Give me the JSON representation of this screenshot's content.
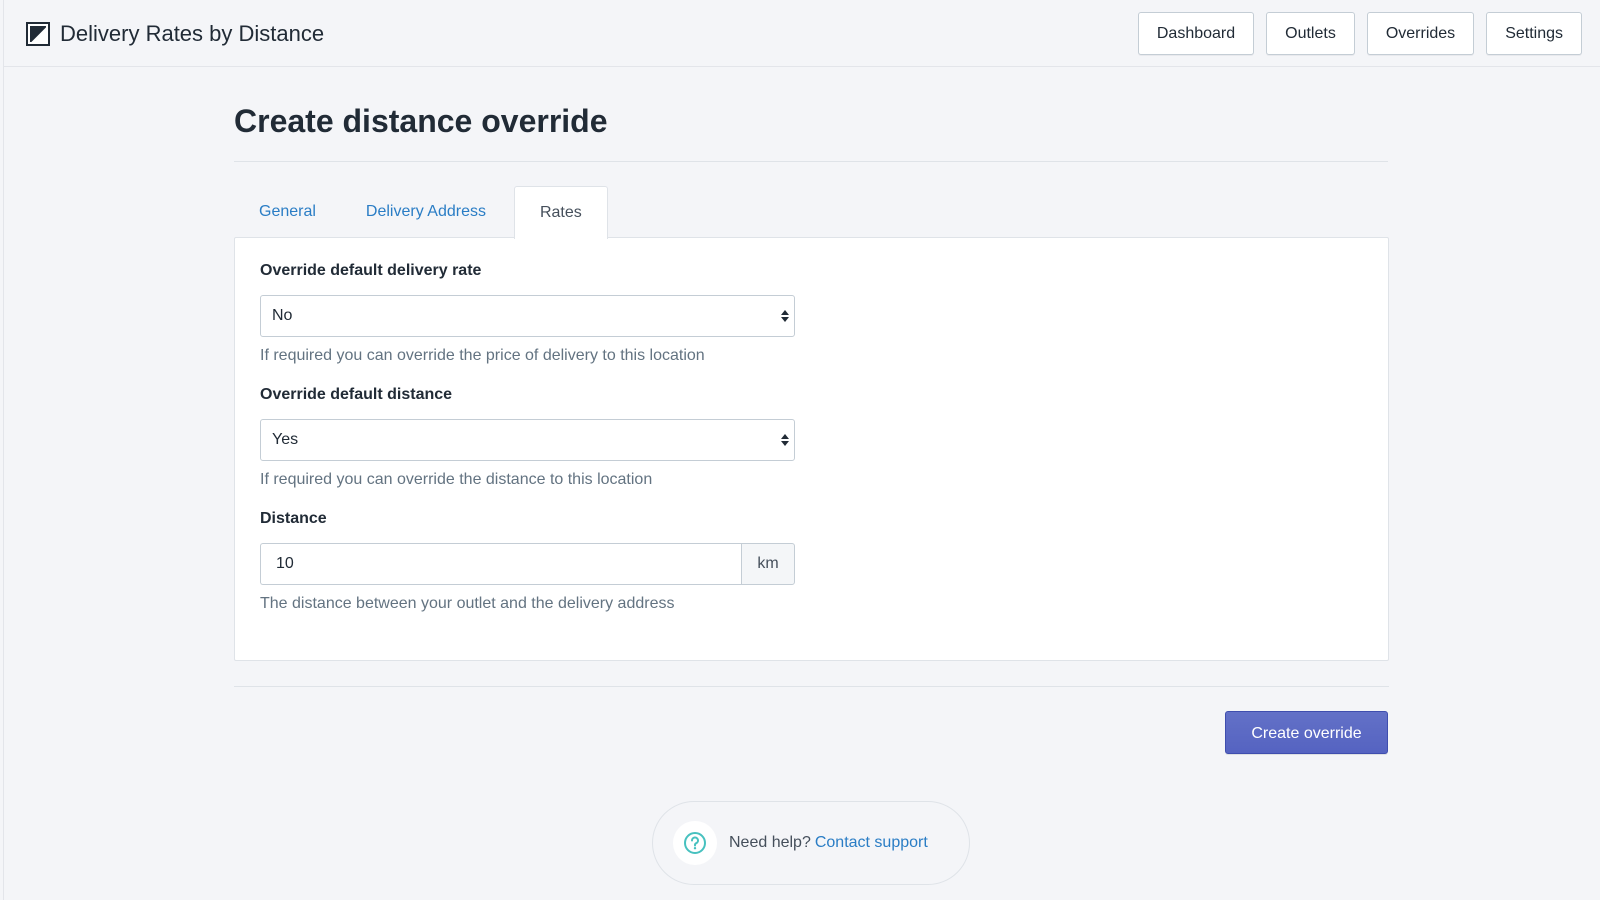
{
  "app": {
    "title": "Delivery Rates by Distance",
    "logo_icon": "app-logo-icon"
  },
  "nav": {
    "items": [
      {
        "label": "Dashboard"
      },
      {
        "label": "Outlets"
      },
      {
        "label": "Overrides"
      },
      {
        "label": "Settings"
      }
    ]
  },
  "page": {
    "title": "Create distance override"
  },
  "tabs": [
    {
      "label": "General",
      "active": false
    },
    {
      "label": "Delivery Address",
      "active": false
    },
    {
      "label": "Rates",
      "active": true
    }
  ],
  "form": {
    "override_rate": {
      "label": "Override default delivery rate",
      "value": "No",
      "help": "If required you can override the price of delivery to this location"
    },
    "override_distance": {
      "label": "Override default distance",
      "value": "Yes",
      "help": "If required you can override the distance to this location"
    },
    "distance": {
      "label": "Distance",
      "value": "10",
      "unit": "km",
      "help": "The distance between your outlet and the delivery address"
    }
  },
  "actions": {
    "submit_label": "Create override"
  },
  "footer": {
    "help_prefix": "Need help?",
    "help_link": "Contact support",
    "help_icon": "question-circle-icon"
  },
  "colors": {
    "primary": "#5c6ac4",
    "link": "#2a7dc5",
    "help_icon": "#47c1bf"
  }
}
